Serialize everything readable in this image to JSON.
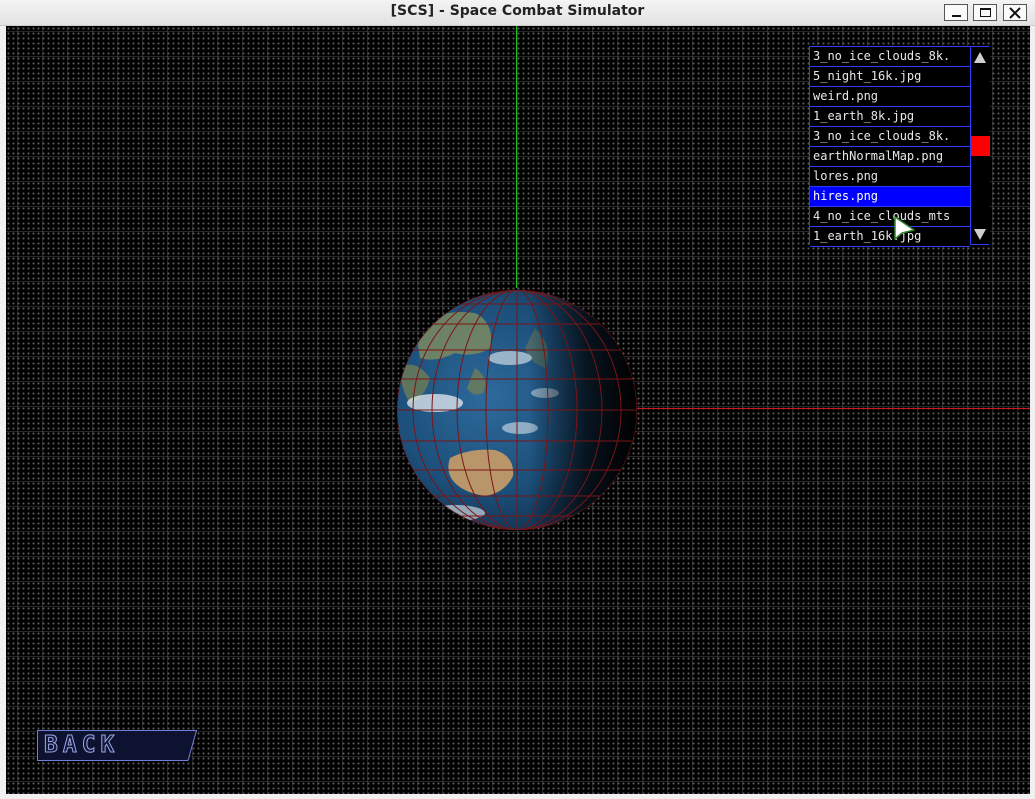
{
  "window": {
    "title": "[SCS] - Space Combat Simulator",
    "controls": [
      "minimize-icon",
      "maximize-icon",
      "close-icon"
    ]
  },
  "texture_list": {
    "items": [
      {
        "label": "3_no_ice_clouds_8k.",
        "selected": false
      },
      {
        "label": "5_night_16k.jpg",
        "selected": false
      },
      {
        "label": "weird.png",
        "selected": false
      },
      {
        "label": "1_earth_8k.jpg",
        "selected": false
      },
      {
        "label": "3_no_ice_clouds_8k.",
        "selected": false
      },
      {
        "label": "earthNormalMap.png",
        "selected": false
      },
      {
        "label": "lores.png",
        "selected": false
      },
      {
        "label": "hires.png",
        "selected": true
      },
      {
        "label": "4_no_ice_clouds_mts",
        "selected": false
      },
      {
        "label": "1_earth_16k.jpg",
        "selected": false
      }
    ],
    "selected_label": "hires.png",
    "scrollbar": {
      "up_icon": "triangle-up-icon",
      "down_icon": "triangle-down-icon",
      "thumb_color": "#ff0000"
    }
  },
  "back_button": {
    "label": "BACK"
  },
  "colors": {
    "axis_y": "#1fc21f",
    "axis_x": "#cc1818",
    "list_border": "#2b3cff",
    "selection": "#0000ff",
    "wireframe": "#7a1414"
  }
}
